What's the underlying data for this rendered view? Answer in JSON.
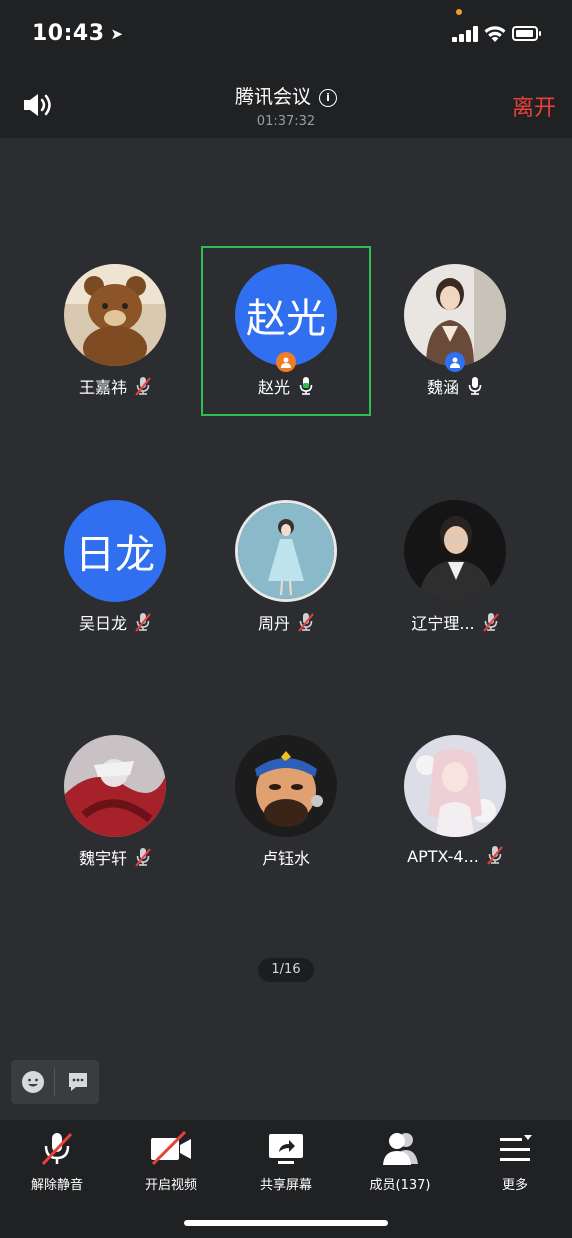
{
  "status": {
    "time": "10:43"
  },
  "header": {
    "title": "腾讯会议",
    "duration": "01:37:32",
    "leave_label": "离开"
  },
  "participants": [
    {
      "name": "王嘉祎",
      "avatar": "bear-photo",
      "mic": "muted"
    },
    {
      "name": "赵光",
      "avatar_text": "赵光",
      "avatar_color": "#2f6ff0",
      "mic": "on",
      "speaking": true,
      "badge": "host"
    },
    {
      "name": "魏涵",
      "avatar": "person-photo",
      "mic": "on",
      "badge": "cohost"
    },
    {
      "name": "吴日龙",
      "avatar_text": "日龙",
      "avatar_color": "#2f6ff0",
      "mic": "muted"
    },
    {
      "name": "周丹",
      "avatar": "girl-illustration",
      "mic": "muted"
    },
    {
      "name": "辽宁理...",
      "avatar": "man-photo",
      "mic": "muted"
    },
    {
      "name": "魏宇轩",
      "avatar": "anime-red",
      "mic": "muted"
    },
    {
      "name": "卢钰水",
      "avatar": "cartoon-man",
      "mic": "off"
    },
    {
      "name": "APTX-4...",
      "avatar": "anime-girl",
      "mic": "muted"
    }
  ],
  "pager": "1/16",
  "toolbar": {
    "unmute": "解除静音",
    "video": "开启视频",
    "share": "共享屏幕",
    "members": "成员(137)",
    "more": "更多"
  },
  "colors": {
    "accent": "#2f6ff0",
    "leave": "#e8413c",
    "speaking_border": "#2fbe53",
    "mute_slash": "#e8413c"
  }
}
